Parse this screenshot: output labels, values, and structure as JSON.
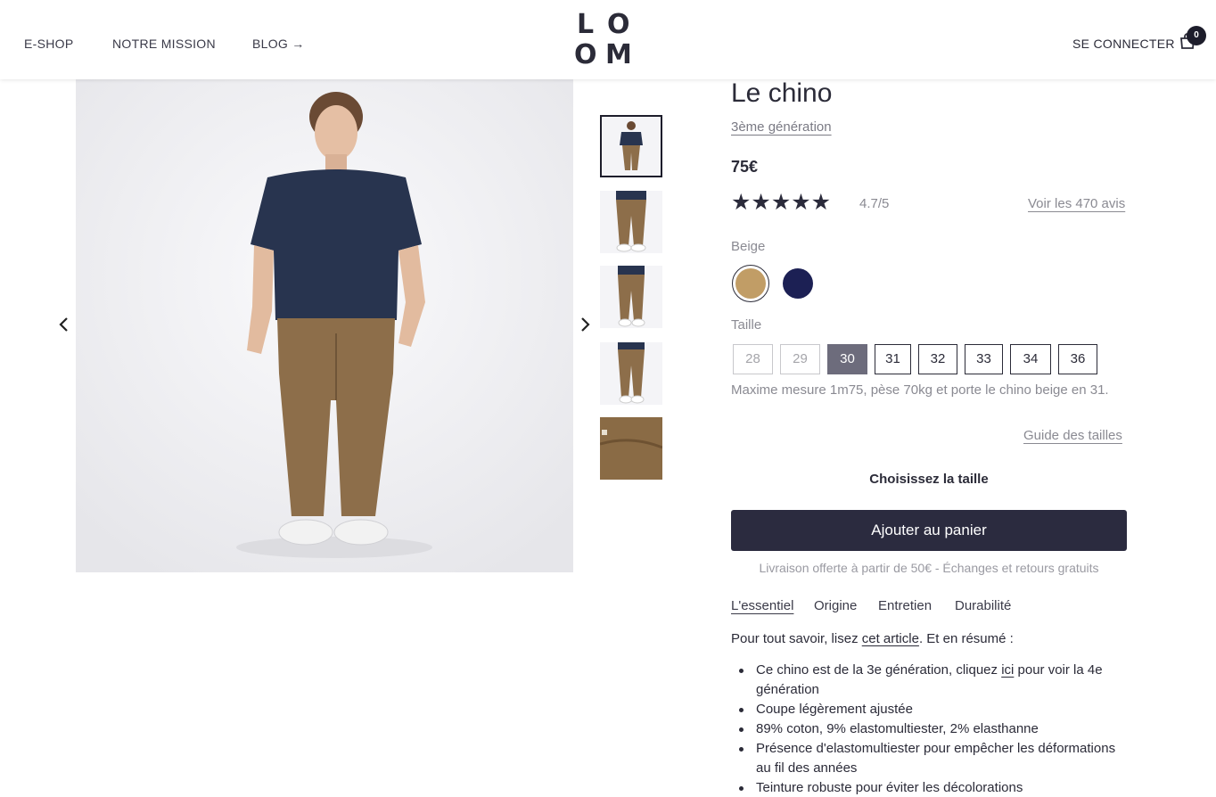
{
  "nav": {
    "eshop": "E-SHOP",
    "mission": "NOTRE MISSION",
    "blog": "BLOG →"
  },
  "logo": {
    "letters": [
      "L",
      "O",
      "O",
      "M"
    ]
  },
  "header": {
    "login": "SE CONNECTER",
    "cart_count": "0",
    "cart_icon": "shopping-bag-icon"
  },
  "gallery": {
    "prev_icon": "chevron-left-icon",
    "next_icon": "chevron-right-icon"
  },
  "product": {
    "title": "Le chino",
    "generation": "3ème génération",
    "price": "75€",
    "stars": "★★★★★",
    "rating": "4.7/5",
    "reviews_link": "Voir les 470 avis",
    "color_label": "Beige",
    "colors": [
      {
        "name": "Beige",
        "hex": "#c19d66"
      },
      {
        "name": "Navy",
        "hex": "#1c2054"
      }
    ],
    "size_label": "Taille",
    "sizes": [
      "28",
      "29",
      "30",
      "31",
      "32",
      "33",
      "34",
      "36"
    ],
    "selected_size": "30",
    "disabled_sizes": [
      "28",
      "29"
    ],
    "size_note": "Maxime mesure 1m75, pèse 70kg et porte le chino beige en 31.",
    "size_guide": "Guide des tailles",
    "choose_size": "Choisissez la taille",
    "add_to_cart": "Ajouter au panier",
    "delivery": "Livraison offerte à partir de 50€ - Échanges et retours gratuits"
  },
  "tabs": [
    "L'essentiel",
    "Origine",
    "Entretien",
    "Durabilité"
  ],
  "content": {
    "intro_prefix": "Pour tout savoir, lisez ",
    "intro_link": "cet article",
    "intro_suffix": ". Et en résumé :",
    "bullet1_prefix": "Ce chino est de la 3e génération, cliquez ",
    "bullet1_link": "ici",
    "bullet1_suffix": " pour voir la 4e génération",
    "bullet2": "Coupe légèrement ajustée",
    "bullet3": "89% coton, 9% elastomultiester, 2% elasthanne",
    "bullet4": "Présence d'elastomultiester pour empêcher les déformations au fil des années",
    "bullet5": "Teinture robuste pour éviter les décolorations"
  },
  "colors": {
    "accent": "#2b2b3f",
    "selected_size_bg": "#6d6c7c",
    "tshirt": "#28344f",
    "chino": "#8d6e4a"
  }
}
